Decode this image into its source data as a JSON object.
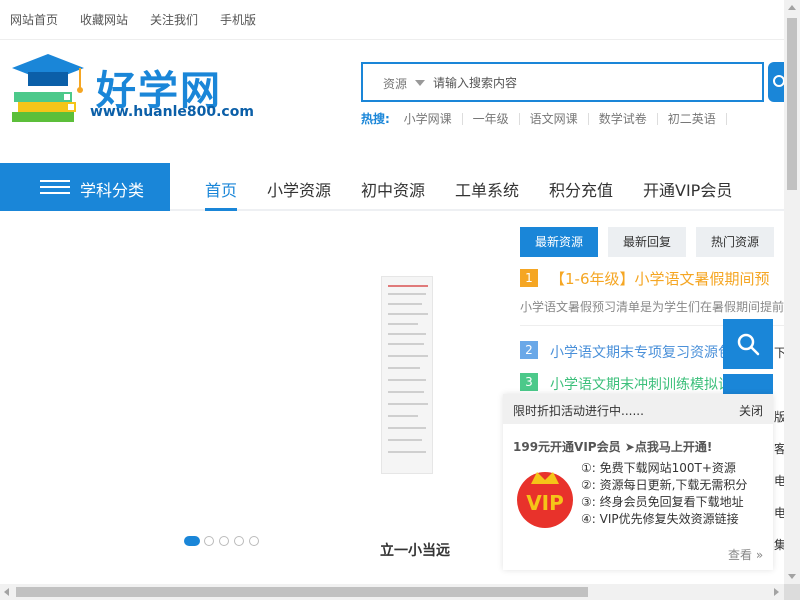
{
  "topbar": {
    "links": [
      "网站首页",
      "收藏网站",
      "关注我们",
      "手机版"
    ]
  },
  "logo": {
    "name": "好学网",
    "url_text": "www.huanle800.com"
  },
  "search": {
    "type_label": "资源",
    "placeholder": "请输入搜索内容"
  },
  "hot": {
    "label": "热搜:",
    "items": [
      "小学网课",
      "一年级",
      "语文网课",
      "数学试卷",
      "初二英语"
    ]
  },
  "nav": {
    "category_label": "学科分类",
    "items": [
      "首页",
      "小学资源",
      "初中资源",
      "工单系统",
      "积分充值",
      "开通VIP会员"
    ],
    "active_index": 0
  },
  "carousel": {
    "caption": "立一小当远",
    "slide_count": 5,
    "active_slide": 0
  },
  "tabs": {
    "items": [
      "最新资源",
      "最新回复",
      "热门资源"
    ],
    "active_index": 0
  },
  "resources": [
    {
      "rank": "1",
      "title": "【1-6年级】小学语文暑假期间预",
      "summary": "小学语文暑假预习清单是为学生们在暑假期间提前"
    },
    {
      "rank": "2",
      "title": "小学语文期末专项复习资源包",
      "summary": ""
    },
    {
      "rank": "3",
      "title": "小学语文期末冲刺训练模拟试题",
      "summary": ""
    }
  ],
  "popup": {
    "title": "限时折扣活动进行中......",
    "close_label": "关闭",
    "promo": "199元开通VIP会员 ➤点我马上开通!",
    "vip_text": "VIP",
    "benefits": [
      "①: 免费下载网站100T+资源",
      "②: 资源每日更新,下载无需积分",
      "③: 终身会员免回复看下载地址",
      "④: VIP优先修复失效资源链接"
    ],
    "more_label": "查看 »"
  },
  "edge_chars": [
    "下",
    "版",
    "客",
    "电",
    "电",
    "集"
  ],
  "colors": {
    "primary": "#1a86d8",
    "rank1": "#f5a623",
    "rank2": "#6aa8e8",
    "rank3": "#4cc98a",
    "title1": "#f5a623",
    "title2": "#4a90d9",
    "title3": "#3bbf7a"
  }
}
